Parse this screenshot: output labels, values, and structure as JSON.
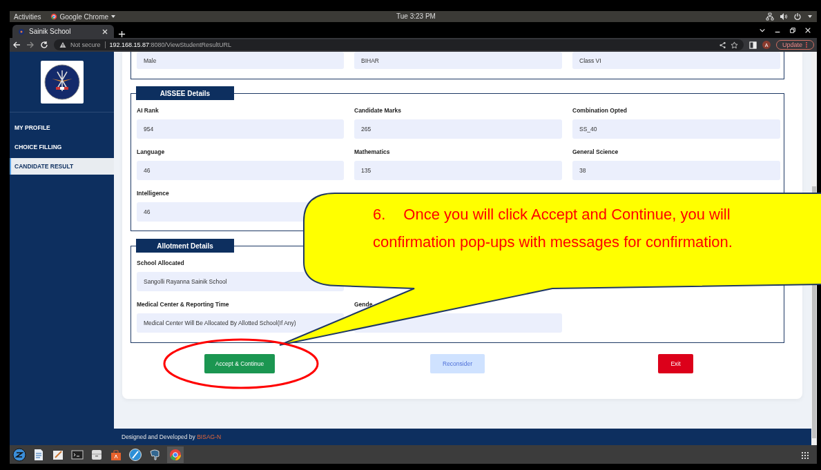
{
  "system_bar": {
    "activities": "Activities",
    "app": "Google Chrome",
    "clock": "Tue  3:23 PM"
  },
  "browser": {
    "tab_title": "Sainik School",
    "security": "Not secure",
    "url_host": "192.168.15.87",
    "url_rest": ":8080/ViewStudentResultURL",
    "profile_initial": "A",
    "update_label": "Update"
  },
  "sidebar": {
    "items": [
      {
        "label": "MY PROFILE",
        "selected": false
      },
      {
        "label": "CHOICE FILLING",
        "selected": false
      },
      {
        "label": "CANDIDATE RESULT",
        "selected": true
      }
    ]
  },
  "sections": [
    {
      "rows": [
        [
          {
            "value": "Male"
          },
          {
            "value": "BIHAR"
          },
          {
            "value": "Class VI"
          }
        ]
      ]
    },
    {
      "legend": "AISSEE Details",
      "rows": [
        [
          {
            "label": "AI Rank",
            "value": "954"
          },
          {
            "label": "Candidate Marks",
            "value": "265"
          },
          {
            "label": "Combination Opted",
            "value": "SS_40"
          }
        ],
        [
          {
            "label": "Language",
            "value": "46"
          },
          {
            "label": "Mathematics",
            "value": "135"
          },
          {
            "label": "General Science",
            "value": "38"
          }
        ],
        [
          {
            "label": "Intelligence",
            "value": "46"
          }
        ]
      ]
    },
    {
      "legend": "Allotment Details",
      "rows": [
        [
          {
            "label": "School Allocated",
            "value": "Sangolli Rayanna Sainik School"
          }
        ],
        [
          {
            "label": "Medical Center & Reporting Time",
            "value": "Medical Center Will Be Allocated By Allotted School(If Any)"
          },
          {
            "label": "Gende"
          }
        ]
      ]
    }
  ],
  "buttons": [
    {
      "label": "Accept & Continue",
      "kind": "primary"
    },
    {
      "label": "Reconsider",
      "kind": "secondary"
    },
    {
      "label": "Exit",
      "kind": "danger"
    }
  ],
  "footer": {
    "text": "Designed and Developed by",
    "link": "BISAG-N"
  },
  "callout": {
    "number": "6.",
    "lines": [
      "Once you will click Accept and Continue, you will",
      "confirmation pop-ups with messages for confirmation."
    ]
  }
}
